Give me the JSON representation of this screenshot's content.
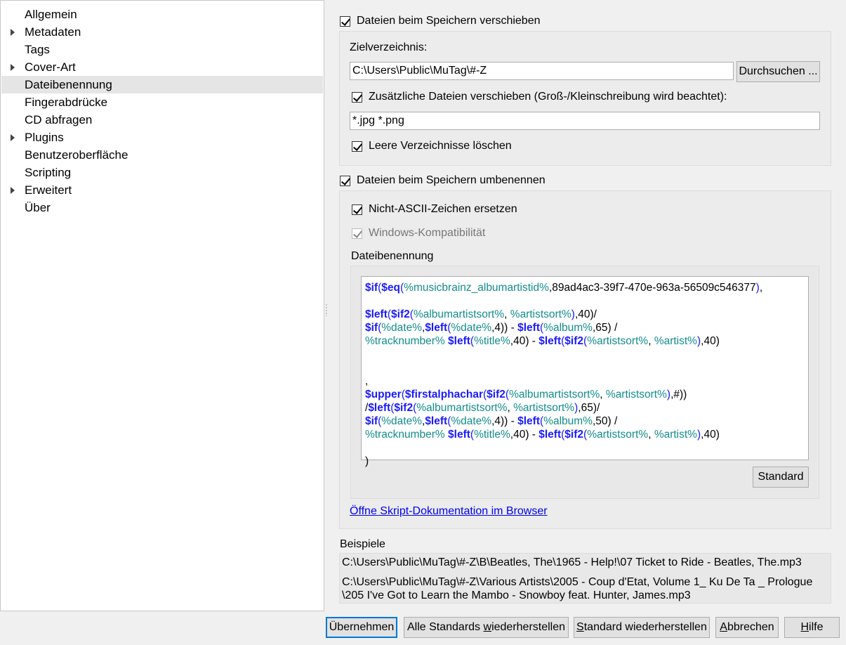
{
  "sidebar": {
    "items": [
      {
        "label": "Allgemein",
        "expandable": false
      },
      {
        "label": "Metadaten",
        "expandable": true
      },
      {
        "label": "Tags",
        "expandable": false
      },
      {
        "label": "Cover-Art",
        "expandable": true
      },
      {
        "label": "Dateibenennung",
        "expandable": false,
        "selected": true
      },
      {
        "label": "Fingerabdrücke",
        "expandable": false
      },
      {
        "label": "CD abfragen",
        "expandable": false
      },
      {
        "label": "Plugins",
        "expandable": true
      },
      {
        "label": "Benutzeroberfläche",
        "expandable": false
      },
      {
        "label": "Scripting",
        "expandable": false
      },
      {
        "label": "Erweitert",
        "expandable": true
      },
      {
        "label": "Über",
        "expandable": false
      }
    ]
  },
  "move": {
    "checkbox_label": "Dateien beim Speichern verschieben",
    "target_label": "Zielverzeichnis:",
    "target_value": "C:\\Users\\Public\\MuTag\\#-Z",
    "browse_label": "Durchsuchen ...",
    "extra_files_label": "Zusätzliche Dateien verschieben (Groß-/Kleinschreibung wird beachtet):",
    "extra_files_value": "*.jpg *.png",
    "delete_empty_label": "Leere Verzeichnisse löschen"
  },
  "rename": {
    "checkbox_label": "Dateien beim Speichern umbenennen",
    "ascii_label": "Nicht-ASCII-Zeichen ersetzen",
    "windows_label": "Windows-Kompatibilität",
    "naming_label": "Dateibenennung",
    "default_label": "Standard",
    "doc_link": "Öffne Skript-Dokumentation im Browser"
  },
  "script_lines": [
    [
      [
        "fn",
        "$if"
      ],
      [
        "par",
        "("
      ],
      [
        "fn",
        "$eq"
      ],
      [
        "par",
        "("
      ],
      [
        "var",
        "%musicbrainz_albumartistid%"
      ],
      [
        "txt",
        ",89ad4ac3-39f7-470e-963a-56509c546377"
      ],
      [
        "par",
        ")"
      ],
      [
        "txt",
        ","
      ]
    ],
    [],
    [
      [
        "fn",
        "$left"
      ],
      [
        "par",
        "("
      ],
      [
        "fn",
        "$if2"
      ],
      [
        "par",
        "("
      ],
      [
        "var",
        "%albumartistsort%"
      ],
      [
        "txt",
        ", "
      ],
      [
        "var",
        "%artistsort%"
      ],
      [
        "par",
        ")"
      ],
      [
        "txt",
        ",40)/"
      ]
    ],
    [
      [
        "fn",
        "$if"
      ],
      [
        "par",
        "("
      ],
      [
        "var",
        "%date%"
      ],
      [
        "txt",
        ","
      ],
      [
        "fn",
        "$left"
      ],
      [
        "par",
        "("
      ],
      [
        "var",
        "%date%"
      ],
      [
        "txt",
        ",4)) - "
      ],
      [
        "fn",
        "$left"
      ],
      [
        "par",
        "("
      ],
      [
        "var",
        "%album%"
      ],
      [
        "txt",
        ",65) /"
      ]
    ],
    [
      [
        "var",
        "%tracknumber%"
      ],
      [
        "txt",
        " "
      ],
      [
        "fn",
        "$left"
      ],
      [
        "par",
        "("
      ],
      [
        "var",
        "%title%"
      ],
      [
        "txt",
        ",40) - "
      ],
      [
        "fn",
        "$left"
      ],
      [
        "par",
        "("
      ],
      [
        "fn",
        "$if2"
      ],
      [
        "par",
        "("
      ],
      [
        "var",
        "%artistsort%"
      ],
      [
        "txt",
        ", "
      ],
      [
        "var",
        "%artist%"
      ],
      [
        "par",
        ")"
      ],
      [
        "txt",
        ",40)"
      ]
    ],
    [],
    [],
    [
      [
        "txt",
        ","
      ]
    ],
    [
      [
        "fn",
        "$upper"
      ],
      [
        "par",
        "("
      ],
      [
        "fn",
        "$firstalphachar"
      ],
      [
        "par",
        "("
      ],
      [
        "fn",
        "$if2"
      ],
      [
        "par",
        "("
      ],
      [
        "var",
        "%albumartistsort%"
      ],
      [
        "txt",
        ", "
      ],
      [
        "var",
        "%artistsort%"
      ],
      [
        "par",
        ")"
      ],
      [
        "txt",
        ",#))"
      ]
    ],
    [
      [
        "txt",
        "/"
      ],
      [
        "fn",
        "$left"
      ],
      [
        "par",
        "("
      ],
      [
        "fn",
        "$if2"
      ],
      [
        "par",
        "("
      ],
      [
        "var",
        "%albumartistsort%"
      ],
      [
        "txt",
        ", "
      ],
      [
        "var",
        "%artistsort%"
      ],
      [
        "par",
        ")"
      ],
      [
        "txt",
        ",65)/"
      ]
    ],
    [
      [
        "fn",
        "$if"
      ],
      [
        "par",
        "("
      ],
      [
        "var",
        "%date%"
      ],
      [
        "txt",
        ","
      ],
      [
        "fn",
        "$left"
      ],
      [
        "par",
        "("
      ],
      [
        "var",
        "%date%"
      ],
      [
        "txt",
        ",4)) - "
      ],
      [
        "fn",
        "$left"
      ],
      [
        "par",
        "("
      ],
      [
        "var",
        "%album%"
      ],
      [
        "txt",
        ",50) /"
      ]
    ],
    [
      [
        "var",
        "%tracknumber%"
      ],
      [
        "txt",
        " "
      ],
      [
        "fn",
        "$left"
      ],
      [
        "par",
        "("
      ],
      [
        "var",
        "%title%"
      ],
      [
        "txt",
        ",40) - "
      ],
      [
        "fn",
        "$left"
      ],
      [
        "par",
        "("
      ],
      [
        "fn",
        "$if2"
      ],
      [
        "par",
        "("
      ],
      [
        "var",
        "%artistsort%"
      ],
      [
        "txt",
        ", "
      ],
      [
        "var",
        "%artist%"
      ],
      [
        "par",
        ")"
      ],
      [
        "txt",
        ",40)"
      ]
    ],
    [],
    [
      [
        "txt",
        ")"
      ]
    ]
  ],
  "examples": {
    "label": "Beispiele",
    "line1": "C:\\Users\\Public\\MuTag\\#-Z\\B\\Beatles, The\\1965 - Help!\\07 Ticket to Ride - Beatles, The.mp3",
    "line2a": "C:\\Users\\Public\\MuTag\\#-Z\\Various Artists\\2005 - Coup d'Etat, Volume 1_ Ku De Ta _ Prologue",
    "line2b": "\\205 I've Got to Learn the Mambo - Snowboy feat. Hunter, James.mp3"
  },
  "buttons": {
    "apply": "Übernehmen",
    "restore_all_pre": "Alle Standards ",
    "restore_all_ul": "w",
    "restore_all_post": "iederherstellen",
    "restore_pre": "",
    "restore_ul": "S",
    "restore_post": "tandard wiederherstellen",
    "cancel_pre": "",
    "cancel_ul": "A",
    "cancel_post": "bbrechen",
    "help_pre": "",
    "help_ul": "H",
    "help_post": "ilfe"
  }
}
